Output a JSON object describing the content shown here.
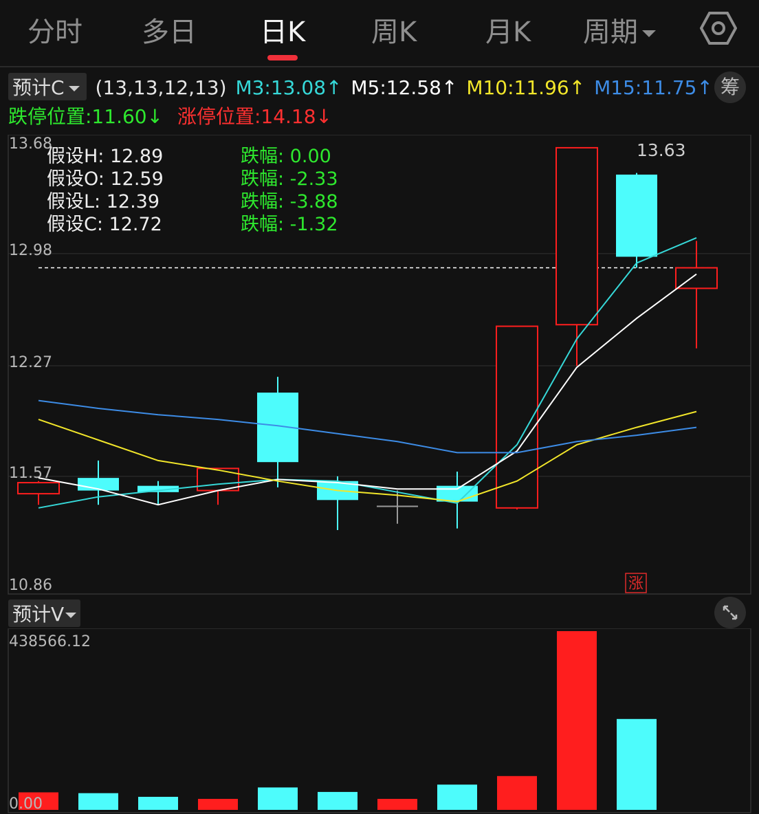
{
  "tabs": [
    {
      "label": "分时"
    },
    {
      "label": "多日"
    },
    {
      "label": "日K"
    },
    {
      "label": "周K"
    },
    {
      "label": "月K"
    },
    {
      "label": "周期"
    }
  ],
  "indicator": {
    "selector": "预计C",
    "params": "(13,13,12,13)",
    "m3": "M3:13.08↑",
    "m5": "M5:12.58↑",
    "m10": "M10:11.96↑",
    "m15": "M15:11.75↑",
    "limit_down": "跌停位置:11.60↓",
    "limit_up": "涨停位置:14.18↓",
    "chou_label": "筹"
  },
  "assume": [
    {
      "label": "假设H: 12.89",
      "change": "跌幅: 0.00"
    },
    {
      "label": "假设O: 12.59",
      "change": "跌幅: -2.33"
    },
    {
      "label": "假设L: 12.39",
      "change": "跌幅: -3.88"
    },
    {
      "label": "假设C: 12.72",
      "change": "跌幅: -1.32"
    }
  ],
  "volume_panel": {
    "selector": "预计V",
    "max_label": "438566.12",
    "min_label": "0.00"
  },
  "colors": {
    "up": "#ff1e1e",
    "down": "#4dfcfc",
    "m3": "#36d8d8",
    "m5": "#ffffff",
    "m10": "#f2e62a",
    "m15": "#3d8ce6",
    "limit_down": "#2ee82e",
    "limit_up": "#ff3030"
  },
  "chart_data": {
    "type": "candlestick",
    "price_axis": {
      "ylim": [
        10.86,
        13.68
      ],
      "ticks": [
        "13.68",
        "12.98",
        "12.27",
        "11.57",
        "10.86"
      ]
    },
    "reference_price": 12.89,
    "high_annotation": "13.63",
    "limit_up_marker": "涨",
    "candles": [
      {
        "o": 11.46,
        "h": 11.54,
        "l": 11.39,
        "c": 11.53,
        "dir": "up"
      },
      {
        "o": 11.56,
        "h": 11.67,
        "l": 11.39,
        "c": 11.48,
        "dir": "down"
      },
      {
        "o": 11.51,
        "h": 11.54,
        "l": 11.39,
        "c": 11.47,
        "dir": "down"
      },
      {
        "o": 11.48,
        "h": 11.56,
        "l": 11.39,
        "c": 11.62,
        "dir": "up"
      },
      {
        "o": 12.1,
        "h": 12.2,
        "l": 11.5,
        "c": 11.66,
        "dir": "down"
      },
      {
        "o": 11.54,
        "h": 11.57,
        "l": 11.23,
        "c": 11.42,
        "dir": "down"
      },
      {
        "o": 11.38,
        "h": 11.48,
        "l": 11.27,
        "c": 11.38,
        "dir": "flat"
      },
      {
        "o": 11.51,
        "h": 11.6,
        "l": 11.24,
        "c": 11.41,
        "dir": "down"
      },
      {
        "o": 11.37,
        "h": 12.52,
        "l": 11.36,
        "c": 12.52,
        "dir": "up"
      },
      {
        "o": 12.53,
        "h": 13.65,
        "l": 12.27,
        "c": 13.65,
        "dir": "up"
      },
      {
        "o": 13.48,
        "h": 13.49,
        "l": 12.89,
        "c": 12.96,
        "dir": "down"
      },
      {
        "o": 12.76,
        "h": 13.06,
        "l": 12.38,
        "c": 12.89,
        "dir": "up"
      }
    ],
    "series": [
      {
        "name": "M3",
        "values": [
          11.37,
          11.44,
          11.48,
          11.52,
          11.55,
          11.54,
          11.47,
          11.4,
          11.77,
          12.44,
          12.92,
          13.08
        ]
      },
      {
        "name": "M5",
        "values": [
          11.56,
          11.49,
          11.39,
          11.48,
          11.55,
          11.53,
          11.49,
          11.49,
          11.73,
          12.26,
          12.57,
          12.85
        ]
      },
      {
        "name": "M10",
        "values": [
          11.93,
          11.8,
          11.67,
          11.61,
          11.54,
          11.48,
          11.45,
          11.41,
          11.54,
          11.77,
          11.88,
          11.98
        ]
      },
      {
        "name": "M15",
        "values": [
          12.05,
          12.0,
          11.96,
          11.93,
          11.89,
          11.84,
          11.79,
          11.72,
          11.72,
          11.79,
          11.83,
          11.88
        ]
      }
    ],
    "volume": {
      "ylim": [
        0,
        438566.12
      ],
      "values": [
        {
          "v": 43000,
          "dir": "up"
        },
        {
          "v": 41000,
          "dir": "down"
        },
        {
          "v": 32000,
          "dir": "down"
        },
        {
          "v": 27000,
          "dir": "up"
        },
        {
          "v": 55000,
          "dir": "down"
        },
        {
          "v": 44000,
          "dir": "down"
        },
        {
          "v": 27000,
          "dir": "up"
        },
        {
          "v": 62000,
          "dir": "down"
        },
        {
          "v": 83000,
          "dir": "up"
        },
        {
          "v": 438566,
          "dir": "up"
        },
        {
          "v": 223000,
          "dir": "down"
        }
      ]
    }
  }
}
